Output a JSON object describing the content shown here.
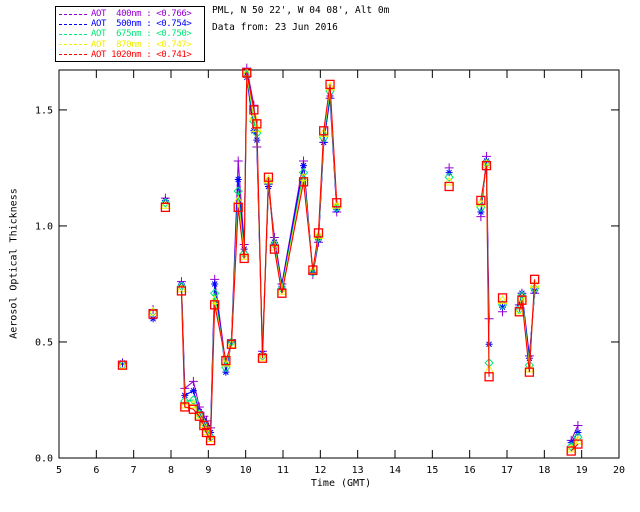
{
  "ui": {
    "header": {
      "line1": "PML, N 50 22', W 04 08', Alt 0m",
      "line2": "Data from: 23 Jun 2016"
    },
    "background_color": "#ffffff",
    "axis_color": "#000000"
  },
  "chart_data": {
    "type": "line",
    "title": "",
    "xlabel": "Time (GMT)",
    "ylabel": "Aerosol Optical Thickness",
    "xlim": [
      5,
      20
    ],
    "ylim": [
      0,
      1.672
    ],
    "xticks": [
      5,
      6,
      7,
      8,
      9,
      10,
      11,
      12,
      13,
      14,
      15,
      16,
      17,
      18,
      19,
      20
    ],
    "yticks": [
      0.0,
      0.5,
      1.0,
      1.5
    ],
    "grid": false,
    "legend_position": "top-left",
    "series": [
      {
        "wavelength": "400nm",
        "label": "AOT  400nm : <0.766>",
        "mean": 0.766,
        "color": "#9400d3",
        "marker": "plus"
      },
      {
        "wavelength": "500nm",
        "label": "AOT  500nm : <0.754>",
        "mean": 0.754,
        "color": "#0000ff",
        "marker": "asterisk"
      },
      {
        "wavelength": "675nm",
        "label": "AOT  675nm : <0.750>",
        "mean": 0.75,
        "color": "#00e878",
        "marker": "diamond"
      },
      {
        "wavelength": "870nm",
        "label": "AOT  870nm : <0.747>",
        "mean": 0.747,
        "color": "#f0f000",
        "marker": "triangle"
      },
      {
        "wavelength": "1020nm",
        "label": "AOT 1020nm : <0.741>",
        "mean": 0.741,
        "color": "#ff0000",
        "marker": "square"
      }
    ],
    "value_order": [
      "400nm",
      "500nm",
      "675nm",
      "870nm",
      "1020nm"
    ],
    "points": [
      {
        "t": 6.7,
        "join": false,
        "v": [
          0.41,
          0.41,
          0.4,
          0.4,
          0.4
        ]
      },
      {
        "t": 7.52,
        "join": false,
        "v": [
          0.64,
          0.6,
          0.63,
          0.63,
          0.62
        ]
      },
      {
        "t": 7.85,
        "join": false,
        "v": [
          1.12,
          1.11,
          1.1,
          1.09,
          1.08
        ]
      },
      {
        "t": 8.28,
        "join": false,
        "v": [
          0.76,
          0.75,
          0.74,
          0.73,
          0.72
        ]
      },
      {
        "t": 8.37,
        "join": true,
        "v": [
          0.3,
          0.27,
          0.245,
          0.23,
          0.22
        ]
      },
      {
        "t": 8.6,
        "join": true,
        "v": [
          0.33,
          0.29,
          0.25,
          0.23,
          0.21
        ]
      },
      {
        "t": 8.76,
        "join": true,
        "v": [
          0.22,
          0.2,
          0.19,
          0.185,
          0.18
        ]
      },
      {
        "t": 8.88,
        "join": true,
        "v": [
          0.18,
          0.16,
          0.15,
          0.145,
          0.14
        ]
      },
      {
        "t": 8.95,
        "join": true,
        "v": [
          0.16,
          0.14,
          0.125,
          0.115,
          0.11
        ]
      },
      {
        "t": 9.06,
        "join": true,
        "v": [
          0.13,
          0.11,
          0.09,
          0.085,
          0.075
        ]
      },
      {
        "t": 9.17,
        "join": true,
        "v": [
          0.77,
          0.75,
          0.71,
          0.68,
          0.66
        ]
      },
      {
        "t": 9.47,
        "join": true,
        "v": [
          0.4,
          0.37,
          0.39,
          0.41,
          0.42
        ]
      },
      {
        "t": 9.62,
        "join": true,
        "v": [
          0.51,
          0.5,
          0.5,
          0.49,
          0.49
        ]
      },
      {
        "t": 9.8,
        "join": true,
        "v": [
          1.28,
          1.2,
          1.15,
          1.11,
          1.08
        ]
      },
      {
        "t": 9.96,
        "join": true,
        "v": [
          0.92,
          0.9,
          0.88,
          0.87,
          0.86
        ]
      },
      {
        "t": 10.03,
        "join": true,
        "v": [
          1.68,
          1.64,
          1.65,
          1.66,
          1.66
        ]
      },
      {
        "t": 10.22,
        "join": true,
        "v": [
          1.52,
          1.41,
          1.45,
          1.47,
          1.5
        ]
      },
      {
        "t": 10.3,
        "join": true,
        "v": [
          1.34,
          1.37,
          1.4,
          1.42,
          1.44
        ]
      },
      {
        "t": 10.45,
        "join": true,
        "v": [
          0.46,
          0.45,
          0.44,
          0.435,
          0.43
        ]
      },
      {
        "t": 10.61,
        "join": true,
        "v": [
          1.18,
          1.17,
          1.19,
          1.2,
          1.21
        ]
      },
      {
        "t": 10.77,
        "join": true,
        "v": [
          0.95,
          0.93,
          0.92,
          0.91,
          0.9
        ]
      },
      {
        "t": 10.97,
        "join": true,
        "v": [
          0.75,
          0.74,
          0.73,
          0.72,
          0.71
        ]
      },
      {
        "t": 11.55,
        "join": true,
        "v": [
          1.28,
          1.26,
          1.23,
          1.21,
          1.19
        ]
      },
      {
        "t": 11.8,
        "join": true,
        "v": [
          0.79,
          0.8,
          0.8,
          0.81,
          0.81
        ]
      },
      {
        "t": 11.95,
        "join": true,
        "v": [
          0.93,
          0.94,
          0.95,
          0.96,
          0.97
        ]
      },
      {
        "t": 12.09,
        "join": true,
        "v": [
          1.36,
          1.36,
          1.38,
          1.4,
          1.41
        ]
      },
      {
        "t": 12.26,
        "join": true,
        "v": [
          1.55,
          1.56,
          1.58,
          1.6,
          1.61
        ]
      },
      {
        "t": 12.44,
        "join": true,
        "v": [
          1.06,
          1.07,
          1.08,
          1.09,
          1.1
        ]
      },
      {
        "t": 15.45,
        "join": false,
        "v": [
          1.25,
          1.23,
          1.21,
          1.19,
          1.17
        ]
      },
      {
        "t": 16.3,
        "join": false,
        "v": [
          1.04,
          1.06,
          1.08,
          1.1,
          1.11
        ]
      },
      {
        "t": 16.45,
        "join": true,
        "v": [
          1.3,
          1.28,
          1.27,
          1.265,
          1.26
        ]
      },
      {
        "t": 16.52,
        "join": true,
        "v": [
          0.6,
          0.49,
          0.41,
          0.38,
          0.35
        ]
      },
      {
        "t": 16.88,
        "join": false,
        "v": [
          0.63,
          0.65,
          0.66,
          0.68,
          0.69
        ]
      },
      {
        "t": 17.33,
        "join": false,
        "v": [
          0.66,
          0.65,
          0.64,
          0.635,
          0.63
        ]
      },
      {
        "t": 17.4,
        "join": true,
        "v": [
          0.71,
          0.71,
          0.7,
          0.69,
          0.68
        ]
      },
      {
        "t": 17.6,
        "join": true,
        "v": [
          0.44,
          0.43,
          0.4,
          0.385,
          0.37
        ]
      },
      {
        "t": 17.74,
        "join": true,
        "v": [
          0.71,
          0.72,
          0.73,
          0.75,
          0.77
        ]
      },
      {
        "t": 18.72,
        "join": false,
        "v": [
          0.076,
          0.066,
          0.05,
          0.04,
          0.03
        ]
      },
      {
        "t": 18.9,
        "join": true,
        "v": [
          0.14,
          0.11,
          0.09,
          0.075,
          0.06
        ]
      }
    ]
  }
}
